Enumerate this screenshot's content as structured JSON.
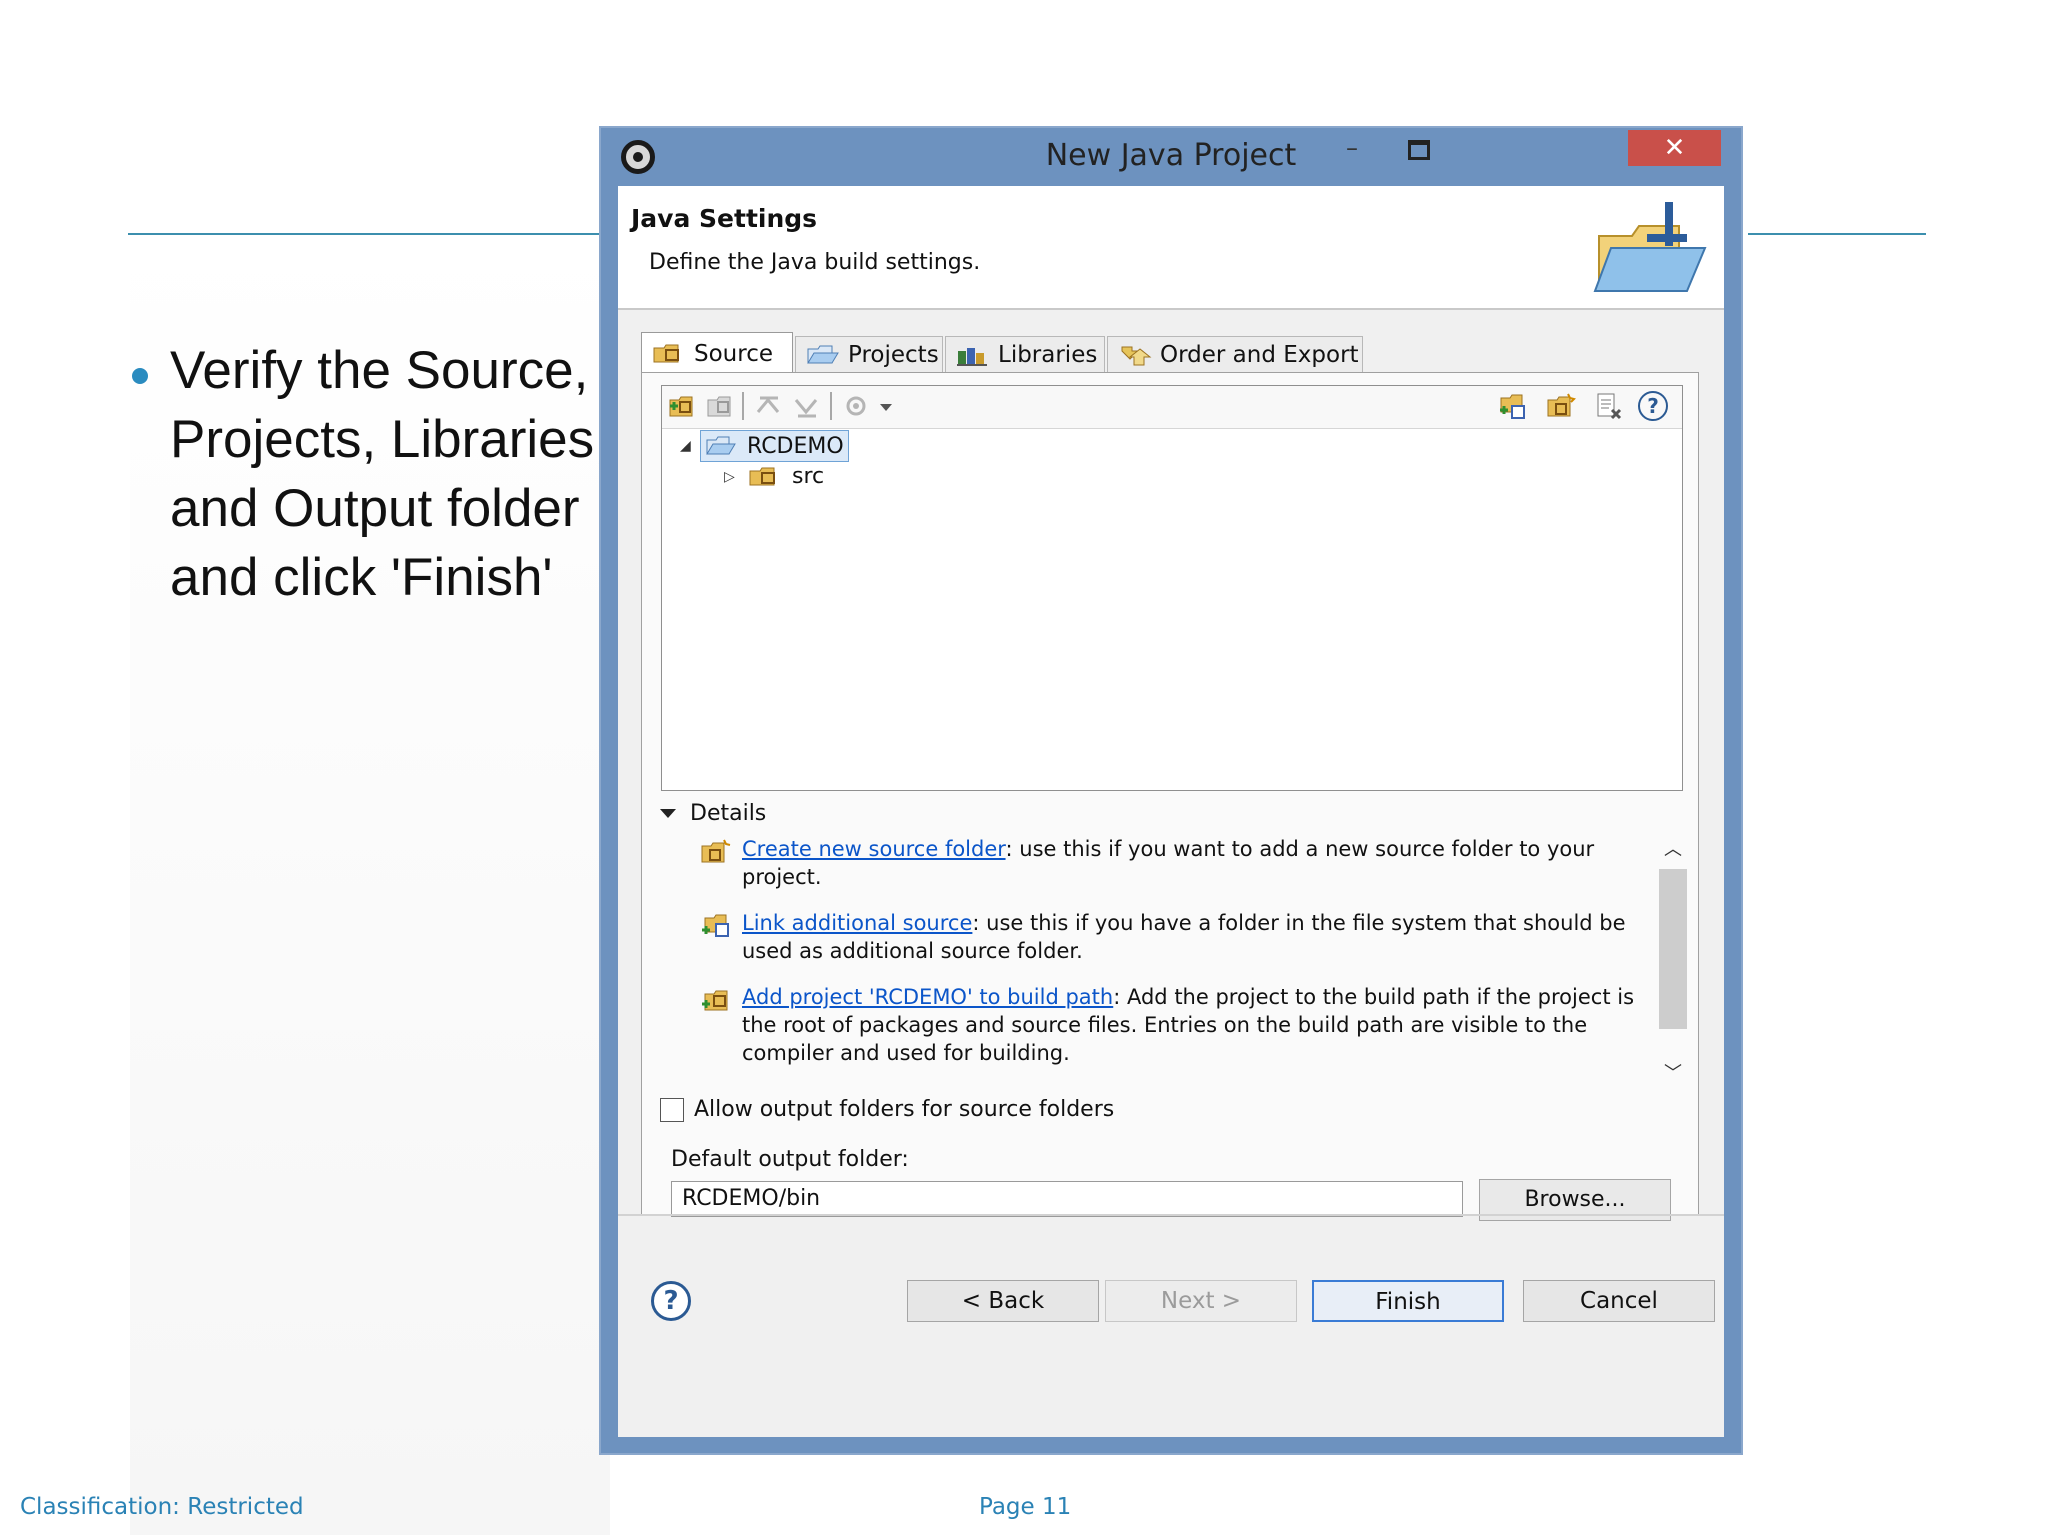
{
  "slide": {
    "bullet": "Verify the Source, Projects, Libraries, and Output folder and click 'Finish'",
    "bullet_lines": [
      "Verify the Source,",
      "Projects, Libraries,",
      "and Output folder",
      "and click 'Finish'"
    ],
    "footer_classification": "Classification: Restricted",
    "footer_page": "Page 11"
  },
  "dialog": {
    "title": "New Java Project",
    "controls": {
      "minimize": "–",
      "close": "✕"
    },
    "header": {
      "title": "Java Settings",
      "description": "Define the Java build settings."
    },
    "tabs": [
      {
        "label": "Source",
        "icon": "source-folder-icon",
        "active": true
      },
      {
        "label": "Projects",
        "icon": "projects-folder-icon",
        "active": false
      },
      {
        "label": "Libraries",
        "icon": "libraries-icon",
        "active": false
      },
      {
        "label": "Order and Export",
        "icon": "order-export-icon",
        "active": false
      }
    ],
    "tree": {
      "project": "RCDEMO",
      "children": [
        {
          "label": "src"
        }
      ]
    },
    "details": {
      "heading": "Details",
      "items": [
        {
          "link": "Create new source folder",
          "text": ": use this if you want to add a new source folder to your project."
        },
        {
          "link": "Link additional source",
          "text": ": use this if you have a folder in the file system that should be used as additional source folder."
        },
        {
          "link": "Add project 'RCDEMO' to build path",
          "text": ": Add the project to the build path if the project is the root of packages and source files. Entries on the build path are visible to the compiler and used for building."
        }
      ]
    },
    "allow_output_label": "Allow output folders for source folders",
    "allow_output_checked": false,
    "output_folder_label": "Default output folder:",
    "output_folder_value": "RCDEMO/bin",
    "browse_label": "Browse...",
    "buttons": {
      "back": "< Back",
      "next": "Next >",
      "finish": "Finish",
      "cancel": "Cancel"
    },
    "help_symbol": "?"
  }
}
